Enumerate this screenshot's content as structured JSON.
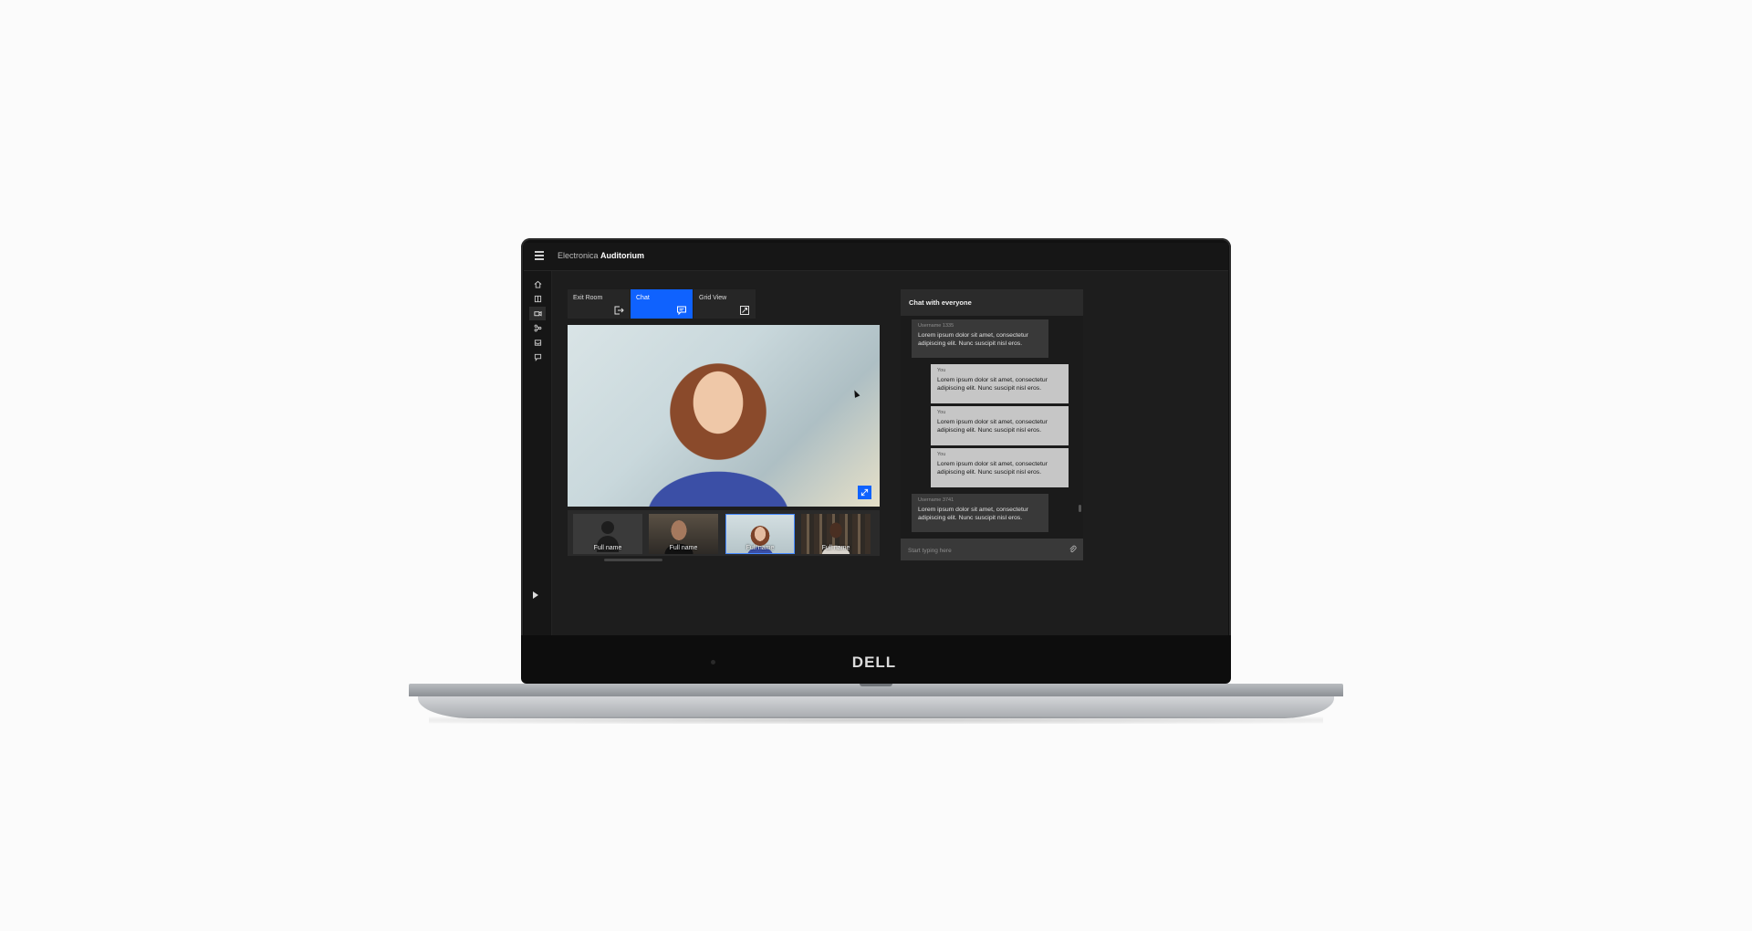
{
  "app": {
    "title_prefix": "Electronica",
    "title_main": "Auditorium"
  },
  "laptop": {
    "brand": "DELL"
  },
  "sidebar": {
    "items": [
      {
        "icon": "home-icon"
      },
      {
        "icon": "book-icon"
      },
      {
        "icon": "video-camera-icon",
        "active": true
      },
      {
        "icon": "network-icon"
      },
      {
        "icon": "inbox-icon"
      },
      {
        "icon": "chat-icon"
      }
    ],
    "bottom_icon": "play-icon"
  },
  "toolbar": {
    "tiles": [
      {
        "label": "Exit Room",
        "icon": "exit-icon"
      },
      {
        "label": "Chat",
        "icon": "chat-icon",
        "active": true
      },
      {
        "label": "Grid View",
        "icon": "grid-view-icon"
      }
    ]
  },
  "video": {
    "expand_icon": "maximize-icon"
  },
  "participants": [
    {
      "name": "Full name"
    },
    {
      "name": "Full name"
    },
    {
      "name": "Full name",
      "selected": true
    },
    {
      "name": "Full name"
    }
  ],
  "chat": {
    "title": "Chat with everyone",
    "messages": [
      {
        "sender": "Username 1335",
        "text": "Lorem ipsum dolor sit amet, consectetur adipiscing elit. Nunc suscipit nisl eros.",
        "mine": false
      },
      {
        "sender": "You",
        "text": "Lorem ipsum dolor sit amet, consectetur adipiscing elit. Nunc suscipit nisl eros.",
        "mine": true
      },
      {
        "sender": "You",
        "text": "Lorem ipsum dolor sit amet, consectetur adipiscing elit. Nunc suscipit nisl eros.",
        "mine": true
      },
      {
        "sender": "You",
        "text": "Lorem ipsum dolor sit amet, consectetur adipiscing elit. Nunc suscipit nisl eros.",
        "mine": true
      },
      {
        "sender": "Username 3741",
        "text": "Lorem ipsum dolor sit amet, consectetur adipiscing elit. Nunc suscipit nisl eros.",
        "mine": false
      }
    ],
    "input_placeholder": "Start typing here",
    "attach_icon": "paperclip-icon"
  },
  "colors": {
    "accent": "#0f62fe",
    "background": "#161616",
    "incoming_bubble": "#393939",
    "outgoing_bubble": "#c6c6c6"
  }
}
